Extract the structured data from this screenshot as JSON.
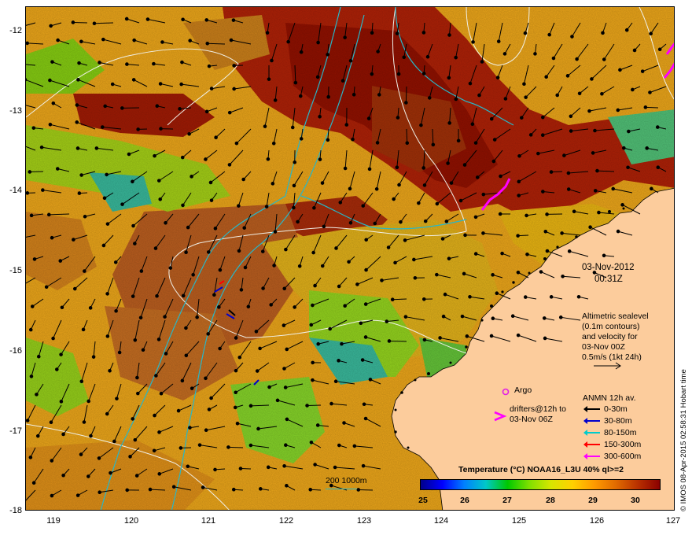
{
  "map": {
    "lat_ticks": [
      "-12",
      "-13",
      "-14",
      "-15",
      "-16",
      "-17",
      "-18"
    ],
    "lon_ticks": [
      "119",
      "120",
      "121",
      "122",
      "123",
      "124",
      "125",
      "126",
      "127"
    ]
  },
  "timestamp": {
    "date": "03-Nov-2012",
    "time": "00:31Z"
  },
  "altimetry_note": {
    "lines": [
      "Altimetric sealevel",
      "(0.1m contours)",
      "and velocity for",
      "03-Nov 00Z",
      "0.5m/s (1kt 24h)"
    ]
  },
  "argo": {
    "label": "Argo",
    "color": "#e21ee6"
  },
  "drifters": {
    "lines": [
      "drifters@12h to",
      "03-Nov 06Z"
    ],
    "color": "#ff00ff"
  },
  "anmn": {
    "title": "ANMN 12h av.",
    "items": [
      {
        "label": "0-30m",
        "color": "#000000"
      },
      {
        "label": "30-80m",
        "color": "#0000cc"
      },
      {
        "label": "80-150m",
        "color": "#00cccc"
      },
      {
        "label": "150-300m",
        "color": "#ff0000"
      },
      {
        "label": "300-600m",
        "color": "#ff00ff"
      }
    ]
  },
  "isobath": {
    "label": "200  1000m",
    "color": "#27b7c8"
  },
  "colorbar": {
    "title": "Temperature (°C) NOAA16_L3U 40% ql>=2",
    "ticks": [
      "25",
      "26",
      "27",
      "28",
      "29",
      "30"
    ],
    "colors": [
      "#00008b",
      "#0000ff",
      "#0080ff",
      "#00c8c8",
      "#00c800",
      "#80e000",
      "#d8e600",
      "#ffd000",
      "#ff9a00",
      "#e06a00",
      "#b83000",
      "#8b0000"
    ]
  },
  "credit": "© IMOS 08-Apr-2015 02:58:31 Hobart time"
}
